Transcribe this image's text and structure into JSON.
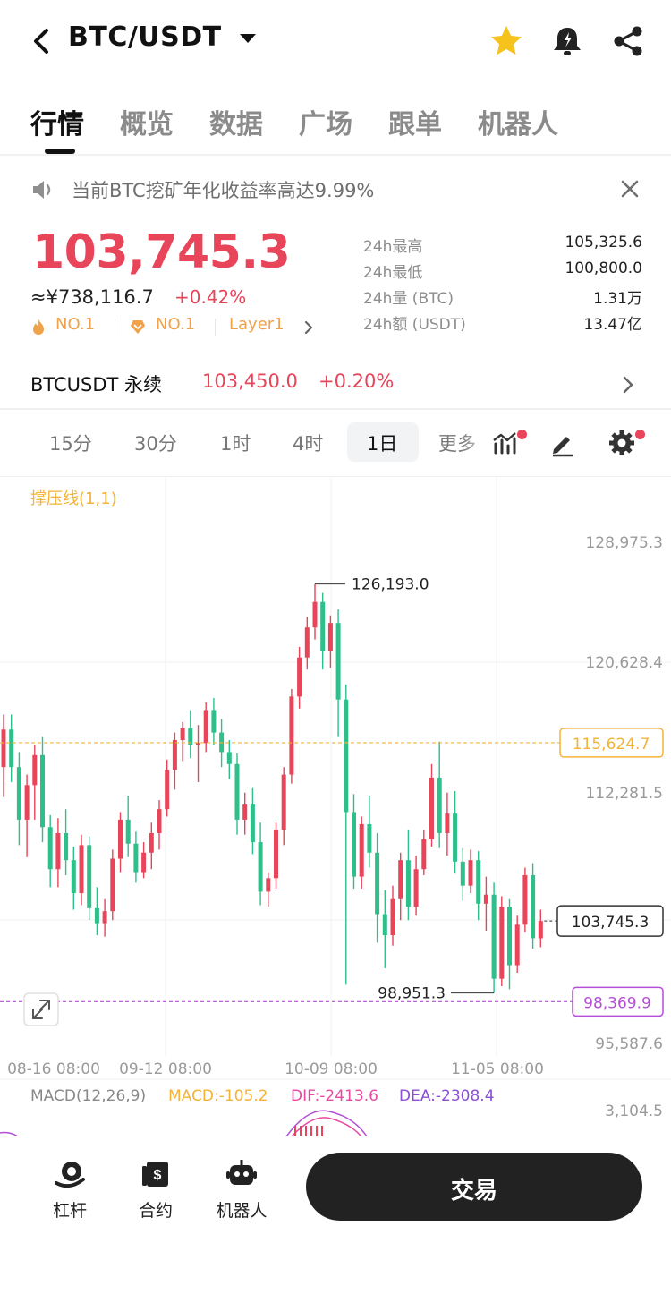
{
  "header": {
    "title": "BTC/USDT"
  },
  "tabs": [
    "行情",
    "概览",
    "数据",
    "广场",
    "跟单",
    "机器人"
  ],
  "notice": {
    "text": "当前BTC挖矿年化收益率高达9.99%"
  },
  "ticker": {
    "last_price": "103,745.3",
    "cny_price": "≈¥738,116.7",
    "change_pct": "+0.42%",
    "badges": [
      "NO.1",
      "NO.1",
      "Layer1"
    ],
    "stats": [
      {
        "label": "24h最高",
        "value": "105,325.6"
      },
      {
        "label": "24h最低",
        "value": "100,800.0"
      },
      {
        "label": "24h量 (BTC)",
        "value": "1.31万"
      },
      {
        "label": "24h额 (USDT)",
        "value": "13.47亿"
      }
    ]
  },
  "perpetual": {
    "name": "BTCUSDT 永续",
    "price": "103,450.0",
    "change_pct": "+0.20%"
  },
  "intervals": [
    "15分",
    "30分",
    "1时",
    "4时",
    "1日",
    "更多"
  ],
  "active_interval": "1日",
  "chart": {
    "indicator_label": "撑压线(1,1)",
    "y_ticks": [
      "128,975.3",
      "120,628.4",
      "112,281.5",
      "95,587.6"
    ],
    "support_line_value": "115,624.7",
    "current_price_tag": "103,745.3",
    "low_line_value": "98,369.9",
    "max_annotation": "126,193.0",
    "min_annotation": "98,951.3",
    "x_ticks": [
      "08-16 08:00",
      "09-12 08:00",
      "10-09 08:00",
      "11-05 08:00"
    ],
    "macd_label": "MACD(12,26,9)",
    "macd_value": "MACD:-105.2",
    "dif_value": "DIF:-2413.6",
    "dea_value": "DEA:-2308.4",
    "macd_tick": "3,104.5",
    "colors": {
      "up": "#e8445a",
      "down": "#2fbf8a",
      "support": "#f3b33a",
      "low": "#b44fd6"
    }
  },
  "chart_data": {
    "type": "candlestick",
    "ylim": [
      95587.6,
      128975.3
    ],
    "candles": [
      [
        114000,
        117500,
        112000,
        116500
      ],
      [
        116500,
        117500,
        113000,
        114000
      ],
      [
        114000,
        115000,
        108800,
        110500
      ],
      [
        110500,
        113500,
        108000,
        112800
      ],
      [
        112800,
        115500,
        110500,
        114800
      ],
      [
        114800,
        116000,
        109000,
        110000
      ],
      [
        110000,
        110800,
        106000,
        107200
      ],
      [
        107200,
        110600,
        106000,
        109600
      ],
      [
        109600,
        111200,
        106800,
        107800
      ],
      [
        107800,
        108700,
        104500,
        105600
      ],
      [
        105600,
        109500,
        104800,
        108800
      ],
      [
        108800,
        109400,
        103800,
        104600
      ],
      [
        104600,
        106000,
        102800,
        103600
      ],
      [
        103600,
        105200,
        102700,
        104400
      ],
      [
        104400,
        108500,
        103800,
        107900
      ],
      [
        107900,
        111000,
        107000,
        110500
      ],
      [
        110500,
        112100,
        108000,
        108900
      ],
      [
        108900,
        109700,
        106300,
        107000
      ],
      [
        107000,
        109000,
        106600,
        108300
      ],
      [
        108300,
        110300,
        107200,
        109600
      ],
      [
        109600,
        111800,
        108500,
        111200
      ],
      [
        111200,
        114500,
        110700,
        113800
      ],
      [
        113800,
        116300,
        112500,
        115800
      ],
      [
        115800,
        117000,
        114400,
        116600
      ],
      [
        116600,
        117800,
        114600,
        115500
      ],
      [
        115500,
        116800,
        113000,
        115600
      ],
      [
        115600,
        118300,
        115000,
        117800
      ],
      [
        117800,
        118600,
        115500,
        116300
      ],
      [
        116300,
        117200,
        114000,
        115000
      ],
      [
        115000,
        115800,
        113200,
        114200
      ],
      [
        114200,
        114900,
        109500,
        110500
      ],
      [
        110500,
        112300,
        109500,
        111500
      ],
      [
        111500,
        112600,
        108200,
        109000
      ],
      [
        109000,
        110300,
        104800,
        105700
      ],
      [
        105700,
        107000,
        104700,
        106600
      ],
      [
        106600,
        110300,
        105900,
        109800
      ],
      [
        109800,
        114000,
        108800,
        113500
      ],
      [
        113500,
        119200,
        112900,
        118700
      ],
      [
        118700,
        122000,
        117900,
        121300
      ],
      [
        121300,
        124000,
        120500,
        123300
      ],
      [
        123300,
        126193,
        122500,
        125000
      ],
      [
        125000,
        125600,
        120500,
        121700
      ],
      [
        121700,
        124100,
        120600,
        123600
      ],
      [
        123600,
        124500,
        116000,
        118500
      ],
      [
        118500,
        119500,
        99500,
        111000
      ],
      [
        111000,
        112200,
        105900,
        106700
      ],
      [
        106700,
        110700,
        105900,
        110200
      ],
      [
        110200,
        112100,
        107300,
        108300
      ],
      [
        108300,
        109600,
        102300,
        104200
      ],
      [
        104200,
        105800,
        100600,
        102800
      ],
      [
        102800,
        106100,
        102100,
        105200
      ],
      [
        105200,
        108300,
        103800,
        107800
      ],
      [
        107800,
        109800,
        103800,
        104700
      ],
      [
        104700,
        108100,
        104100,
        107200
      ],
      [
        107200,
        109800,
        106800,
        109200
      ],
      [
        109200,
        114200,
        108700,
        113300
      ],
      [
        113300,
        115700,
        108600,
        109600
      ],
      [
        109600,
        112300,
        108100,
        110900
      ],
      [
        110900,
        112400,
        106900,
        107700
      ],
      [
        107700,
        108600,
        105100,
        106100
      ],
      [
        106100,
        108500,
        105600,
        107800
      ],
      [
        107800,
        108400,
        103800,
        104900
      ],
      [
        104900,
        106700,
        103100,
        105500
      ],
      [
        105500,
        106300,
        98951.3,
        99900
      ],
      [
        99900,
        105400,
        99400,
        104700
      ],
      [
        104700,
        105200,
        99200,
        100800
      ],
      [
        100800,
        104100,
        100300,
        103500
      ],
      [
        103500,
        107300,
        103000,
        106800
      ],
      [
        106800,
        107600,
        101900,
        102600
      ],
      [
        102600,
        104500,
        102000,
        103745.3
      ]
    ],
    "x_labels": [
      "08-16 08:00",
      "09-12 08:00",
      "10-09 08:00",
      "11-05 08:00"
    ]
  },
  "bottom_nav": {
    "items": [
      "杠杆",
      "合约",
      "机器人"
    ],
    "trade_label": "交易"
  }
}
